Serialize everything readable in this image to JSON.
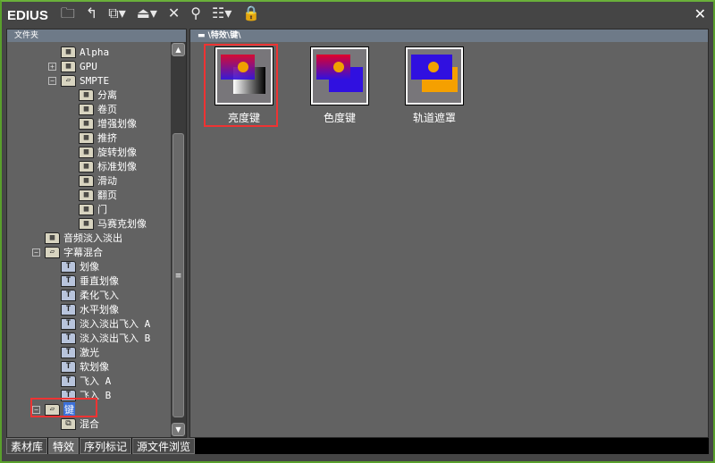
{
  "app": {
    "title": "EDIUS",
    "close": "✕"
  },
  "toolbar": {
    "icons": [
      "folder-icon",
      "up-icon",
      "new-folder-icon",
      "import-icon",
      "delete-icon",
      "search-icon",
      "view-icon",
      "lock-icon"
    ],
    "glyphs": [
      "🗀",
      "↰",
      "⧉▾",
      "⏏▾",
      "✕",
      "⚲",
      "☷▾",
      "🔒"
    ]
  },
  "left_panel": {
    "title": "文件夹",
    "tree": [
      {
        "label": "Alpha",
        "level": 2,
        "type": "folder"
      },
      {
        "label": "GPU",
        "level": 2,
        "type": "folder",
        "expander": "+"
      },
      {
        "label": "SMPTE",
        "level": 2,
        "type": "folder-open",
        "expander": "−"
      },
      {
        "label": "分离",
        "level": 3,
        "type": "folder"
      },
      {
        "label": "卷页",
        "level": 3,
        "type": "folder"
      },
      {
        "label": "增强划像",
        "level": 3,
        "type": "folder"
      },
      {
        "label": "推挤",
        "level": 3,
        "type": "folder"
      },
      {
        "label": "旋转划像",
        "level": 3,
        "type": "folder"
      },
      {
        "label": "标准划像",
        "level": 3,
        "type": "folder"
      },
      {
        "label": "滑动",
        "level": 3,
        "type": "folder"
      },
      {
        "label": "翻页",
        "level": 3,
        "type": "folder"
      },
      {
        "label": "门",
        "level": 3,
        "type": "folder"
      },
      {
        "label": "马赛克划像",
        "level": 3,
        "type": "folder"
      },
      {
        "label": "音频淡入淡出",
        "level": 1,
        "type": "folder"
      },
      {
        "label": "字幕混合",
        "level": 1,
        "type": "folder-open",
        "expander": "−"
      },
      {
        "label": "划像",
        "level": 2,
        "type": "title"
      },
      {
        "label": "垂直划像",
        "level": 2,
        "type": "title"
      },
      {
        "label": "柔化飞入",
        "level": 2,
        "type": "title"
      },
      {
        "label": "水平划像",
        "level": 2,
        "type": "title"
      },
      {
        "label": "淡入淡出飞入 A",
        "level": 2,
        "type": "title"
      },
      {
        "label": "淡入淡出飞入 B",
        "level": 2,
        "type": "title"
      },
      {
        "label": "激光",
        "level": 2,
        "type": "title"
      },
      {
        "label": "软划像",
        "level": 2,
        "type": "title"
      },
      {
        "label": "飞入 A",
        "level": 2,
        "type": "title"
      },
      {
        "label": "飞入 B",
        "level": 2,
        "type": "title"
      },
      {
        "label": "键",
        "level": 1,
        "type": "folder-open",
        "expander": "−",
        "selected": true
      },
      {
        "label": "混合",
        "level": 2,
        "type": "mix"
      }
    ]
  },
  "right_panel": {
    "path": "\\特效\\键\\",
    "items": [
      {
        "label": "亮度键",
        "selected": true
      },
      {
        "label": "色度键"
      },
      {
        "label": "轨道遮罩"
      }
    ]
  },
  "tabs": [
    {
      "label": "素材库"
    },
    {
      "label": "特效",
      "active": true
    },
    {
      "label": "序列标记"
    },
    {
      "label": "源文件浏览"
    }
  ],
  "colors": {
    "highlight": "#ee3333",
    "border": "#5aa02c"
  }
}
